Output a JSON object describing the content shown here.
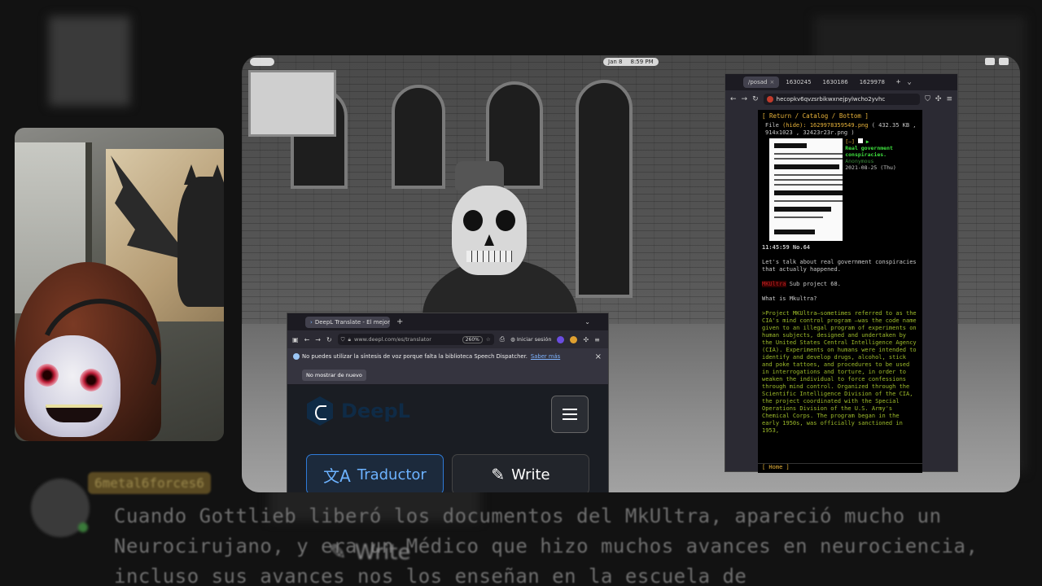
{
  "background": {
    "username": "6metal6forces6",
    "caption": "Cuando Gottlieb liberó los documentos del MkUltra, apareció mucho un Neurocirujano, y era un Médico que hizo muchos avances en neurociencia, incluso sus avances nos los enseñan en la escuela de",
    "write_label": "Write"
  },
  "topbar": {
    "date": "Jan 8",
    "time": "8:59 PM"
  },
  "imageboard": {
    "tabs": [
      {
        "label": "/posad",
        "icon": "tab-favicon"
      },
      {
        "label": "1630245",
        "icon": "tab-favicon"
      },
      {
        "label": "1630186",
        "icon": "tab-favicon"
      },
      {
        "label": "1629978",
        "icon": "tab-favicon"
      }
    ],
    "url": "hecopkv6qvzsrbikwxnejpylwcho2yvhc",
    "nav_links": "[ Return / Catalog / Bottom ]",
    "file_label": "File",
    "file_hide": "(hide):",
    "file_name": "1629978359549.png",
    "file_info": "( 432.35 KB , 914x1023 , 32423r23r.png )",
    "post_controls": "[–]",
    "post_subject": "Real government conspiracies.",
    "post_name": "Anonymous",
    "post_date": "2021-08-25 (Thu)",
    "post_time": "11:45:59 No.64",
    "body_line1": "Let's talk about real government conspiracies that actually happened.",
    "body_red": "MKUltra",
    "body_line2": " Sub project 68.",
    "body_line3": "What is Mkultra?",
    "body_quote": ">Project MKUltra—sometimes referred to as the CIA's mind control program —was the code name given to an illegal program of experiments on human subjects, designed and undertaken by the United States Central Intelligence Agency (CIA). Experiments on humans were intended to identify and develop drugs, alcohol, stick and poke tattoes, and procedures to be used in interrogations and torture, in order to weaken the individual to force confessions through mind control. Organized through the Scientific Intelligence Division of the CIA, the project coordinated with the Special Operations Division of the U.S. Army's Chemical Corps. The program began in the early 1950s, was officially sanctioned in 1953,",
    "bottom_link": "[ Home ]"
  },
  "deepl": {
    "tab_title": "DeepL Translate - El mejor t",
    "url": "www.deepl.com/es/translator",
    "zoom": "260%",
    "signin": "Iniciar sesión",
    "notice": "No puedes utilizar la síntesis de voz porque falta la biblioteca Speech Dispatcher.",
    "notice_link": "Saber más",
    "notice_button": "No mostrar de nuevo",
    "logo_text": "DeepL",
    "translator_label": "Traductor",
    "write_label": "Write"
  },
  "colors": {
    "ib_link": "#e8b33a",
    "ib_subject": "#3ee03e",
    "ib_quote": "#9dbb2a",
    "deepl_accent": "#2f7bd8",
    "deepl_translator_text": "#6cb2ff"
  }
}
